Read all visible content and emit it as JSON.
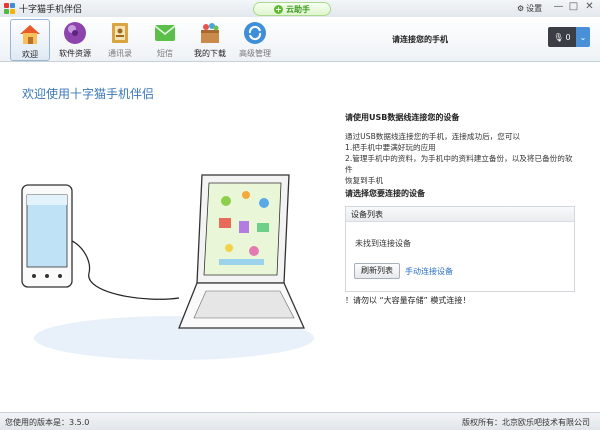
{
  "window": {
    "title": "十字猫手机伴侣",
    "cloud_button": "云助手",
    "settings_label": "设置",
    "min_glyph": "—",
    "max_glyph": "□",
    "close_glyph": "✕"
  },
  "toolbar": {
    "items": [
      {
        "label": "欢迎",
        "icon": "home-icon",
        "active": true
      },
      {
        "label": "软件资源",
        "icon": "software-orb-icon",
        "active": false
      },
      {
        "label": "通讯录",
        "icon": "contacts-book-icon",
        "active": false
      },
      {
        "label": "短信",
        "icon": "sms-envelope-icon",
        "active": false
      },
      {
        "label": "我的下载",
        "icon": "download-box-icon",
        "active": false
      },
      {
        "label": "高级管理",
        "icon": "advanced-manage-icon",
        "active": false
      }
    ],
    "connect_prompt": "请连接您的手机",
    "device_count": "0",
    "device_dropdown_glyph": "⌄"
  },
  "main": {
    "welcome_title": "欢迎使用十字猫手机伴侣",
    "usb_heading": "请使用USB数据线连接您的设备",
    "instructions": [
      "通过USB数据线连接您的手机，连接成功后，您可以",
      "1.把手机中要满好玩的应用",
      "2.管理手机中的资料，为手机中的资料建立备份，以及将已备份的软件",
      "恢复到手机"
    ],
    "select_heading": "请选择您要连接的设备",
    "device_list": {
      "title": "设备列表",
      "empty_message": "未找到连接设备",
      "refresh_button": "刷新列表",
      "manual_link": "手动连接设备"
    },
    "notice": "！请勿以 “大容量存储” 模式连接！"
  },
  "status": {
    "version": "您使用的版本是：3.5.0",
    "copyright": "版权所有：北京欧乐吧技术有限公司"
  },
  "colors": {
    "accent_blue": "#3a78b8",
    "link_blue": "#2a6fc4",
    "cloud_green": "#3c9a1e"
  }
}
